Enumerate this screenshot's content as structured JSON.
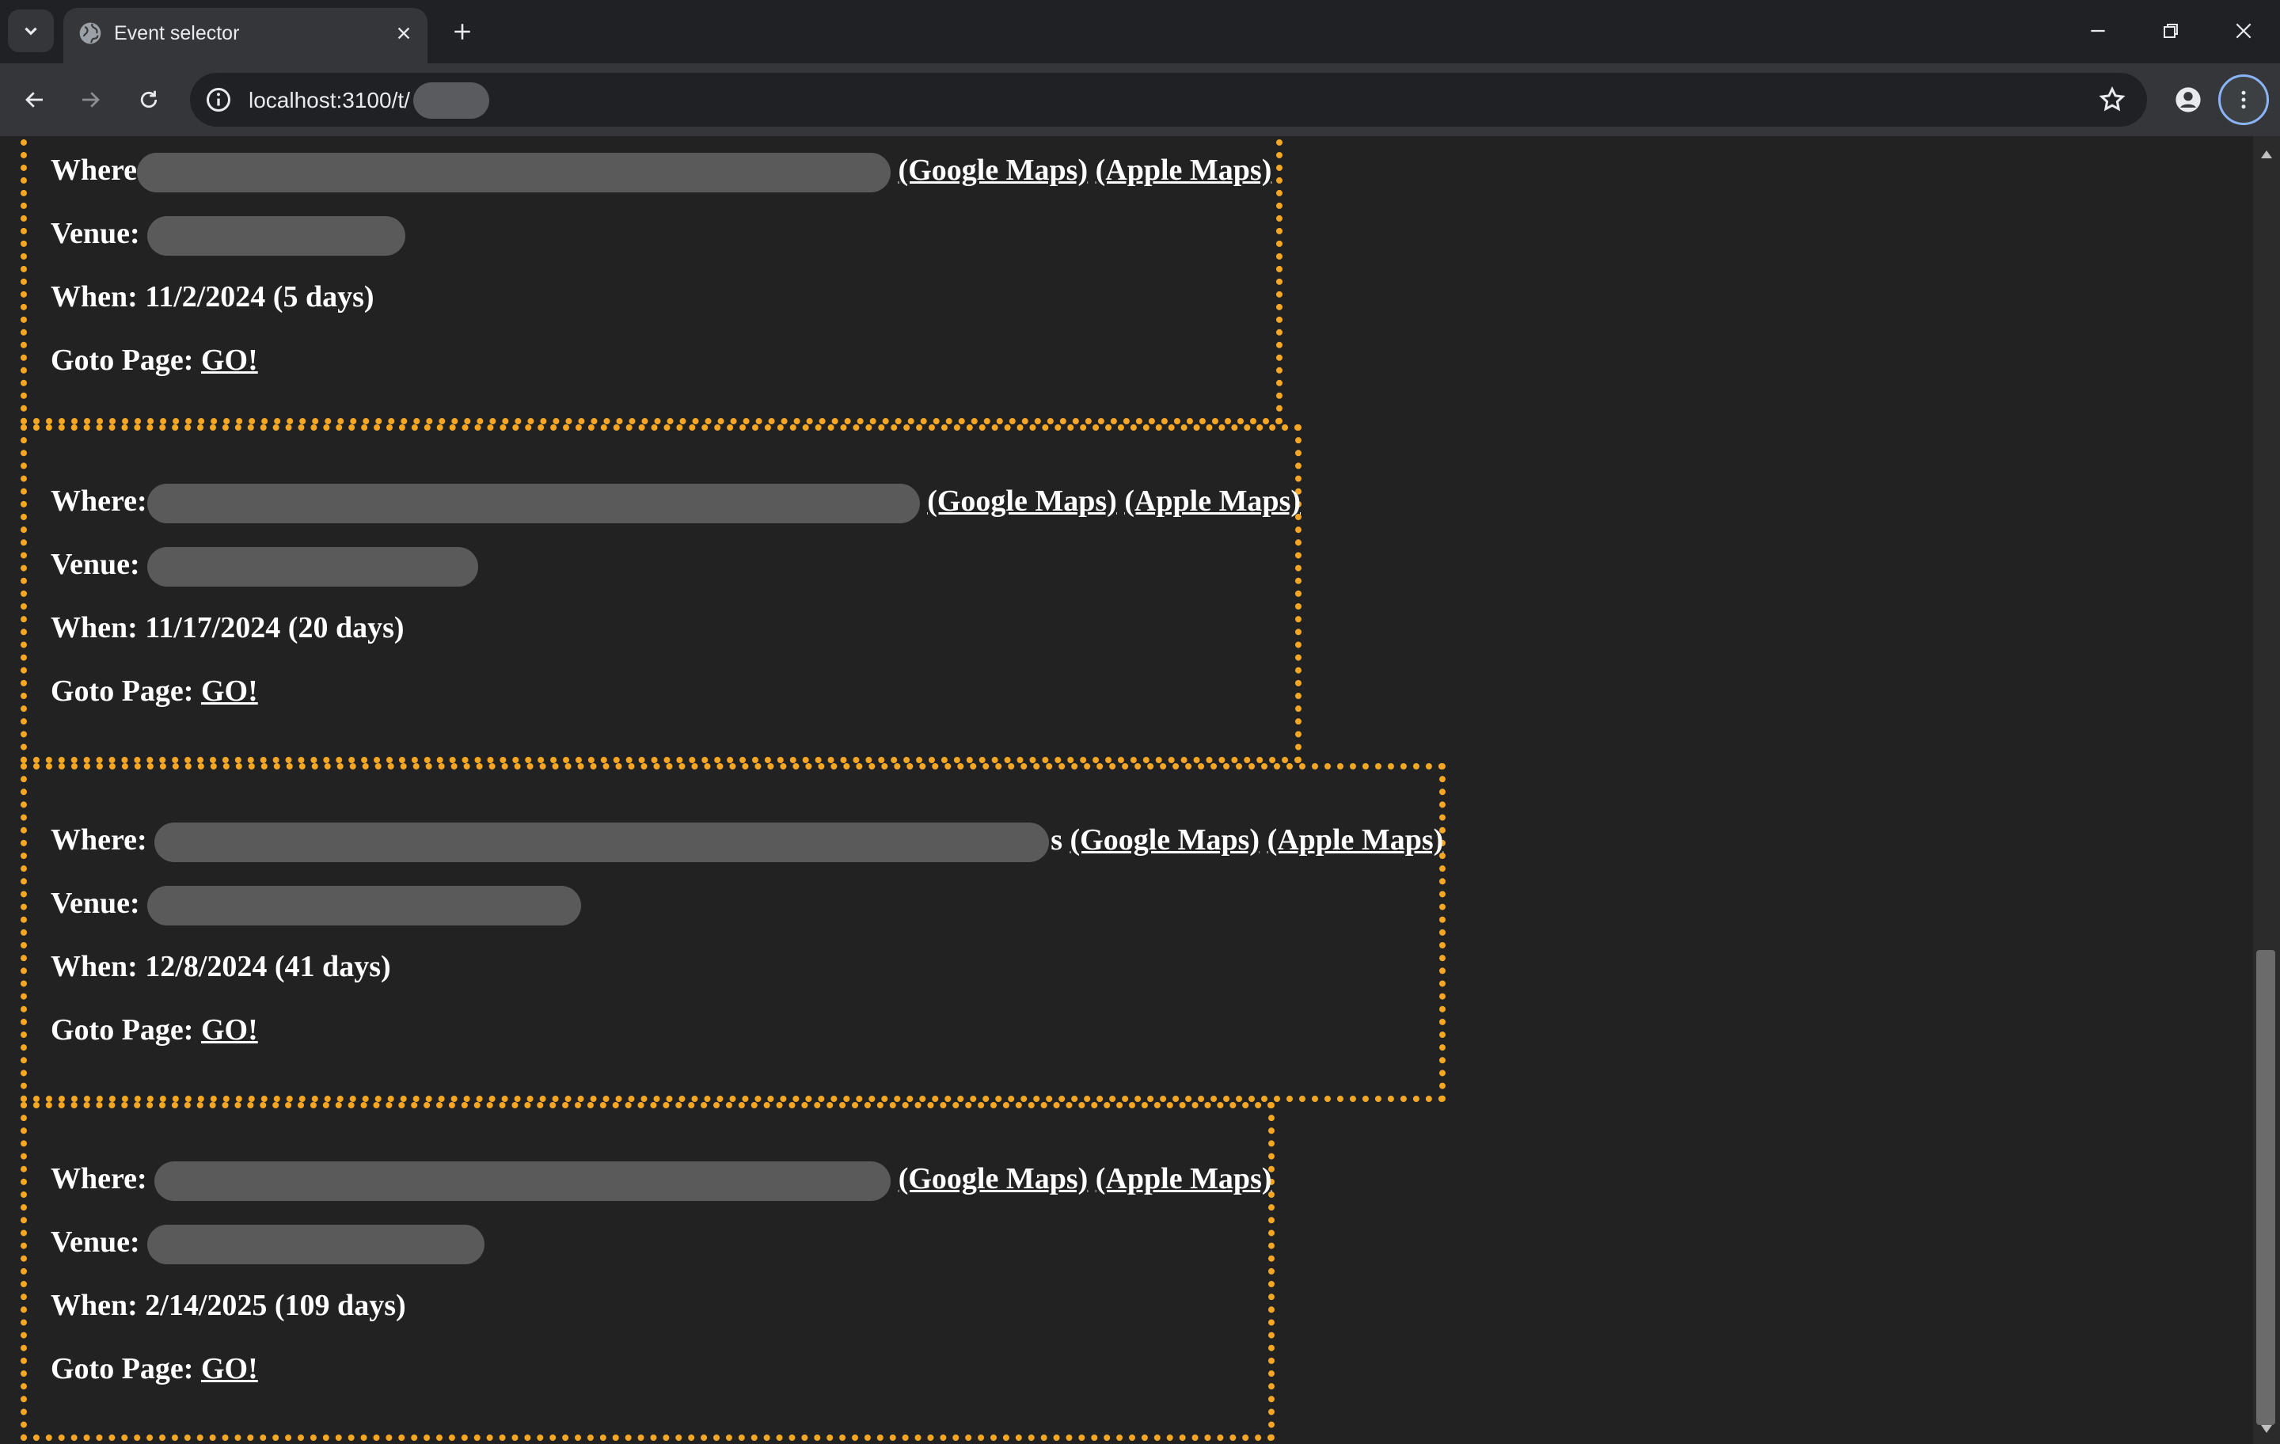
{
  "browser": {
    "tab_title": "Event selector",
    "url": "localhost:3100/t/"
  },
  "labels": {
    "where": "Where:",
    "where_first": "Where",
    "where_third": "Where:",
    "venue": "Venue:",
    "goto": "Goto Page:",
    "go": "GO!",
    "google_maps": "(Google Maps)",
    "apple_maps": "(Apple Maps)"
  },
  "events": [
    {
      "when": "When: 11/2/2024 (5 days)"
    },
    {
      "when": "When: 11/17/2024 (20 days)"
    },
    {
      "when": "When: 12/8/2024 (41 days)",
      "where_tail": "s"
    },
    {
      "when": "When: 2/14/2025 (109 days)"
    }
  ],
  "colors": {
    "border": "#f5a623",
    "page_bg": "#222222",
    "text": "#ffffff",
    "redaction": "#5a5a5a"
  }
}
